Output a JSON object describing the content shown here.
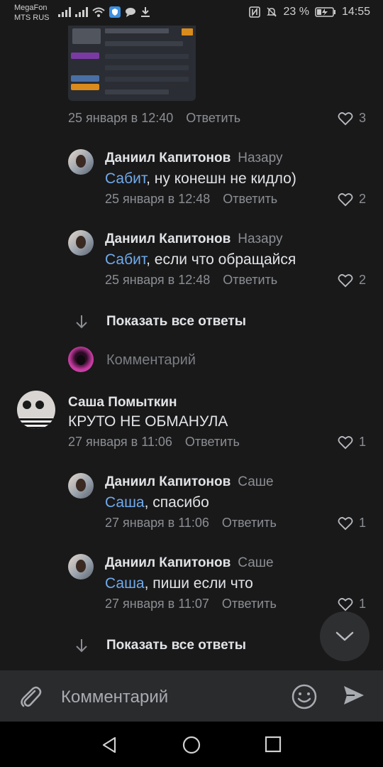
{
  "status_bar": {
    "carrier1": "MegaFon",
    "carrier2": "MTS RUS",
    "battery": "23 %",
    "time": "14:55"
  },
  "top_comment": {
    "date": "25 января в 12:40",
    "reply": "Ответить",
    "likes": "3"
  },
  "replies_1": [
    {
      "author": "Даниил Капитонов",
      "reply_to": "Назару",
      "mention": "Сабит",
      "text": ", ну конешн не кидло)",
      "date": "25 января в 12:48",
      "reply": "Ответить",
      "likes": "2"
    },
    {
      "author": "Даниил Капитонов",
      "reply_to": "Назару",
      "mention": "Сабит",
      "text": ", если что обращайся",
      "date": "25 января в 12:48",
      "reply": "Ответить",
      "likes": "2"
    }
  ],
  "show_all_1": "Показать все ответы",
  "comment_prompt": "Комментарий",
  "comment_2": {
    "author": "Саша Помыткин",
    "text": "КРУТО НЕ ОБМАНУЛА",
    "date": "27 января в 11:06",
    "reply": "Ответить",
    "likes": "1"
  },
  "replies_2": [
    {
      "author": "Даниил Капитонов",
      "reply_to": "Саше",
      "mention": "Саша",
      "text": ", спасибо",
      "date": "27 января в 11:06",
      "reply": "Ответить",
      "likes": "1"
    },
    {
      "author": "Даниил Капитонов",
      "reply_to": "Саше",
      "mention": "Саша",
      "text": ", пиши если что",
      "date": "27 января в 11:07",
      "reply": "Ответить",
      "likes": "1"
    }
  ],
  "show_all_2": "Показать все ответы",
  "input": {
    "placeholder": "Комментарий"
  },
  "icons": {
    "attach": "paperclip-icon",
    "emoji": "emoji-icon",
    "send": "send-icon",
    "like": "heart-icon",
    "scroll_down": "chevron-down-icon",
    "nav_back": "back-triangle-icon",
    "nav_home": "home-circle-icon",
    "nav_recent": "recent-square-icon"
  },
  "colors": {
    "background": "#19191a",
    "accent_link": "#71aaeb",
    "secondary_text": "#8b8e93"
  }
}
